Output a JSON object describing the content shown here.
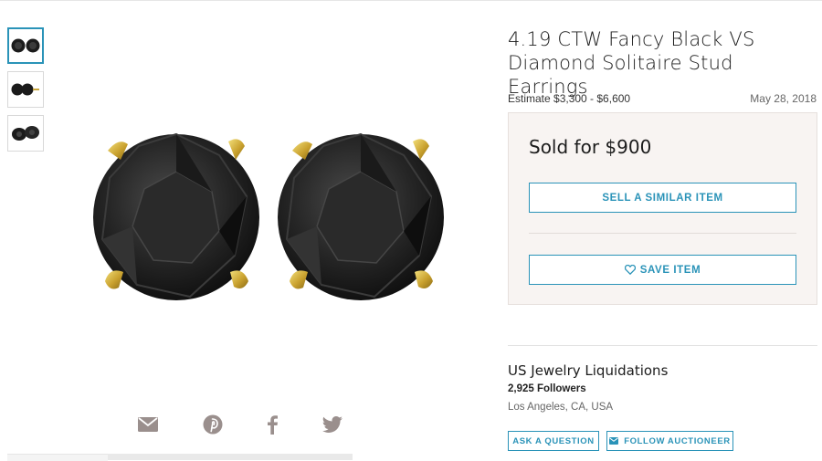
{
  "listing": {
    "title": "4.19 CTW Fancy Black VS Diamond Solitaire Stud Earrings",
    "estimate": "Estimate $3,300 - $6,600",
    "date": "May 28, 2018",
    "sold_label": "Sold for $900",
    "sell_similar_label": "SELL A SIMILAR ITEM",
    "save_label": "SAVE ITEM"
  },
  "gallery": {
    "thumbnails": [
      {
        "icon": "earrings-front-thumbnail",
        "selected": true
      },
      {
        "icon": "earrings-side-thumbnail",
        "selected": false
      },
      {
        "icon": "earrings-angle-thumbnail",
        "selected": false
      }
    ],
    "share_icons": [
      "email-icon",
      "pinterest-icon",
      "facebook-icon",
      "twitter-icon"
    ]
  },
  "seller": {
    "name": "US Jewelry Liquidations",
    "followers": "2,925 Followers",
    "location": "Los Angeles, CA, USA",
    "ask_label": "ASK A QUESTION",
    "follow_label": "FOLLOW AUCTIONEER"
  },
  "colors": {
    "accent": "#2a93b8",
    "sold_box_bg": "#f8f4f2",
    "share_icon": "#9a8f8d",
    "gold_prong": "#d9b93c"
  }
}
